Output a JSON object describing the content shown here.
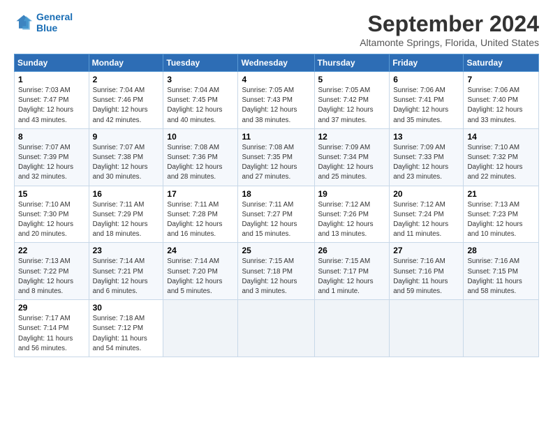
{
  "header": {
    "logo_line1": "General",
    "logo_line2": "Blue",
    "main_title": "September 2024",
    "subtitle": "Altamonte Springs, Florida, United States"
  },
  "calendar": {
    "days_of_week": [
      "Sunday",
      "Monday",
      "Tuesday",
      "Wednesday",
      "Thursday",
      "Friday",
      "Saturday"
    ],
    "weeks": [
      [
        {
          "num": "",
          "info": ""
        },
        {
          "num": "2",
          "info": "Sunrise: 7:04 AM\nSunset: 7:46 PM\nDaylight: 12 hours\nand 42 minutes."
        },
        {
          "num": "3",
          "info": "Sunrise: 7:04 AM\nSunset: 7:45 PM\nDaylight: 12 hours\nand 40 minutes."
        },
        {
          "num": "4",
          "info": "Sunrise: 7:05 AM\nSunset: 7:43 PM\nDaylight: 12 hours\nand 38 minutes."
        },
        {
          "num": "5",
          "info": "Sunrise: 7:05 AM\nSunset: 7:42 PM\nDaylight: 12 hours\nand 37 minutes."
        },
        {
          "num": "6",
          "info": "Sunrise: 7:06 AM\nSunset: 7:41 PM\nDaylight: 12 hours\nand 35 minutes."
        },
        {
          "num": "7",
          "info": "Sunrise: 7:06 AM\nSunset: 7:40 PM\nDaylight: 12 hours\nand 33 minutes."
        }
      ],
      [
        {
          "num": "8",
          "info": "Sunrise: 7:07 AM\nSunset: 7:39 PM\nDaylight: 12 hours\nand 32 minutes."
        },
        {
          "num": "9",
          "info": "Sunrise: 7:07 AM\nSunset: 7:38 PM\nDaylight: 12 hours\nand 30 minutes."
        },
        {
          "num": "10",
          "info": "Sunrise: 7:08 AM\nSunset: 7:36 PM\nDaylight: 12 hours\nand 28 minutes."
        },
        {
          "num": "11",
          "info": "Sunrise: 7:08 AM\nSunset: 7:35 PM\nDaylight: 12 hours\nand 27 minutes."
        },
        {
          "num": "12",
          "info": "Sunrise: 7:09 AM\nSunset: 7:34 PM\nDaylight: 12 hours\nand 25 minutes."
        },
        {
          "num": "13",
          "info": "Sunrise: 7:09 AM\nSunset: 7:33 PM\nDaylight: 12 hours\nand 23 minutes."
        },
        {
          "num": "14",
          "info": "Sunrise: 7:10 AM\nSunset: 7:32 PM\nDaylight: 12 hours\nand 22 minutes."
        }
      ],
      [
        {
          "num": "15",
          "info": "Sunrise: 7:10 AM\nSunset: 7:30 PM\nDaylight: 12 hours\nand 20 minutes."
        },
        {
          "num": "16",
          "info": "Sunrise: 7:11 AM\nSunset: 7:29 PM\nDaylight: 12 hours\nand 18 minutes."
        },
        {
          "num": "17",
          "info": "Sunrise: 7:11 AM\nSunset: 7:28 PM\nDaylight: 12 hours\nand 16 minutes."
        },
        {
          "num": "18",
          "info": "Sunrise: 7:11 AM\nSunset: 7:27 PM\nDaylight: 12 hours\nand 15 minutes."
        },
        {
          "num": "19",
          "info": "Sunrise: 7:12 AM\nSunset: 7:26 PM\nDaylight: 12 hours\nand 13 minutes."
        },
        {
          "num": "20",
          "info": "Sunrise: 7:12 AM\nSunset: 7:24 PM\nDaylight: 12 hours\nand 11 minutes."
        },
        {
          "num": "21",
          "info": "Sunrise: 7:13 AM\nSunset: 7:23 PM\nDaylight: 12 hours\nand 10 minutes."
        }
      ],
      [
        {
          "num": "22",
          "info": "Sunrise: 7:13 AM\nSunset: 7:22 PM\nDaylight: 12 hours\nand 8 minutes."
        },
        {
          "num": "23",
          "info": "Sunrise: 7:14 AM\nSunset: 7:21 PM\nDaylight: 12 hours\nand 6 minutes."
        },
        {
          "num": "24",
          "info": "Sunrise: 7:14 AM\nSunset: 7:20 PM\nDaylight: 12 hours\nand 5 minutes."
        },
        {
          "num": "25",
          "info": "Sunrise: 7:15 AM\nSunset: 7:18 PM\nDaylight: 12 hours\nand 3 minutes."
        },
        {
          "num": "26",
          "info": "Sunrise: 7:15 AM\nSunset: 7:17 PM\nDaylight: 12 hours\nand 1 minute."
        },
        {
          "num": "27",
          "info": "Sunrise: 7:16 AM\nSunset: 7:16 PM\nDaylight: 11 hours\nand 59 minutes."
        },
        {
          "num": "28",
          "info": "Sunrise: 7:16 AM\nSunset: 7:15 PM\nDaylight: 11 hours\nand 58 minutes."
        }
      ],
      [
        {
          "num": "29",
          "info": "Sunrise: 7:17 AM\nSunset: 7:14 PM\nDaylight: 11 hours\nand 56 minutes."
        },
        {
          "num": "30",
          "info": "Sunrise: 7:18 AM\nSunset: 7:12 PM\nDaylight: 11 hours\nand 54 minutes."
        },
        {
          "num": "",
          "info": ""
        },
        {
          "num": "",
          "info": ""
        },
        {
          "num": "",
          "info": ""
        },
        {
          "num": "",
          "info": ""
        },
        {
          "num": "",
          "info": ""
        }
      ]
    ],
    "first_row_sunday": {
      "num": "1",
      "info": "Sunrise: 7:03 AM\nSunset: 7:47 PM\nDaylight: 12 hours\nand 43 minutes."
    }
  }
}
